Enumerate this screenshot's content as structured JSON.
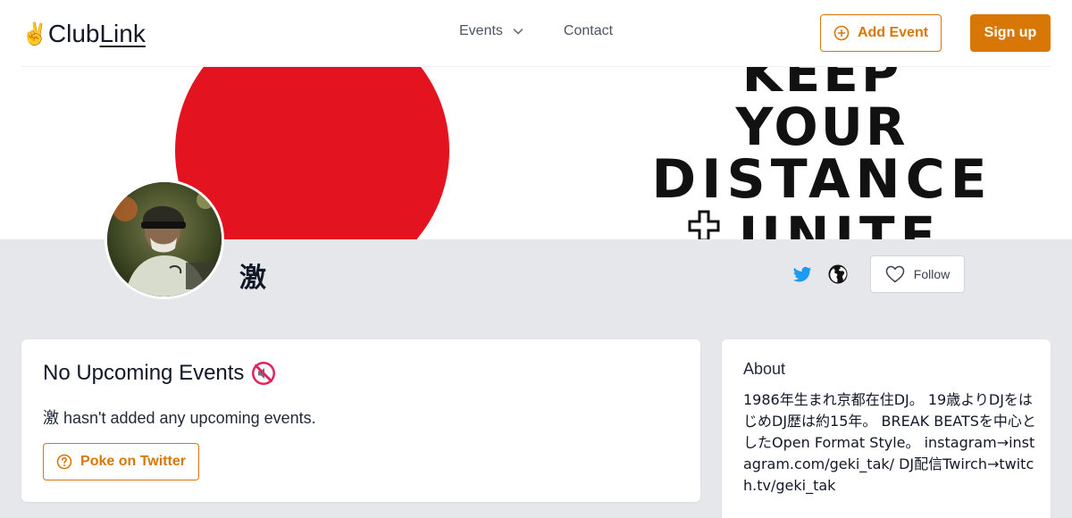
{
  "header": {
    "logo_text_club": "Club",
    "logo_text_link": "Link",
    "logo_icon": "victory-hand-icon",
    "nav": {
      "events_label": "Events",
      "contact_label": "Contact"
    },
    "add_event_label": "Add Event",
    "sign_up_label": "Sign up"
  },
  "banner": {
    "poster_lines": [
      "KEEP",
      "YOUR",
      "DISTANCE",
      "UNITE"
    ]
  },
  "profile": {
    "name": "激",
    "follow_label": "Follow",
    "links": [
      "twitter-icon",
      "globe-icon"
    ]
  },
  "events_card": {
    "title": "No Upcoming Events",
    "title_icon": "muted-speaker-icon",
    "message": "激 hasn't added any upcoming events.",
    "poke_label": "Poke on Twitter"
  },
  "about_card": {
    "title": "About",
    "text": "1986年生まれ京都在住DJ。 19歳よりDJをはじめDJ歴は約15年。 BREAK BEATSを中心としたOpen Format Style。 instagram→instagram.com/geki_tak/ DJ配信Twirch→twitch.tv/geki_tak"
  },
  "colors": {
    "accent": "#d97706",
    "page_bg": "#e5e7eb",
    "twitter": "#1d9bf0",
    "poster_red": "#e3141f"
  }
}
